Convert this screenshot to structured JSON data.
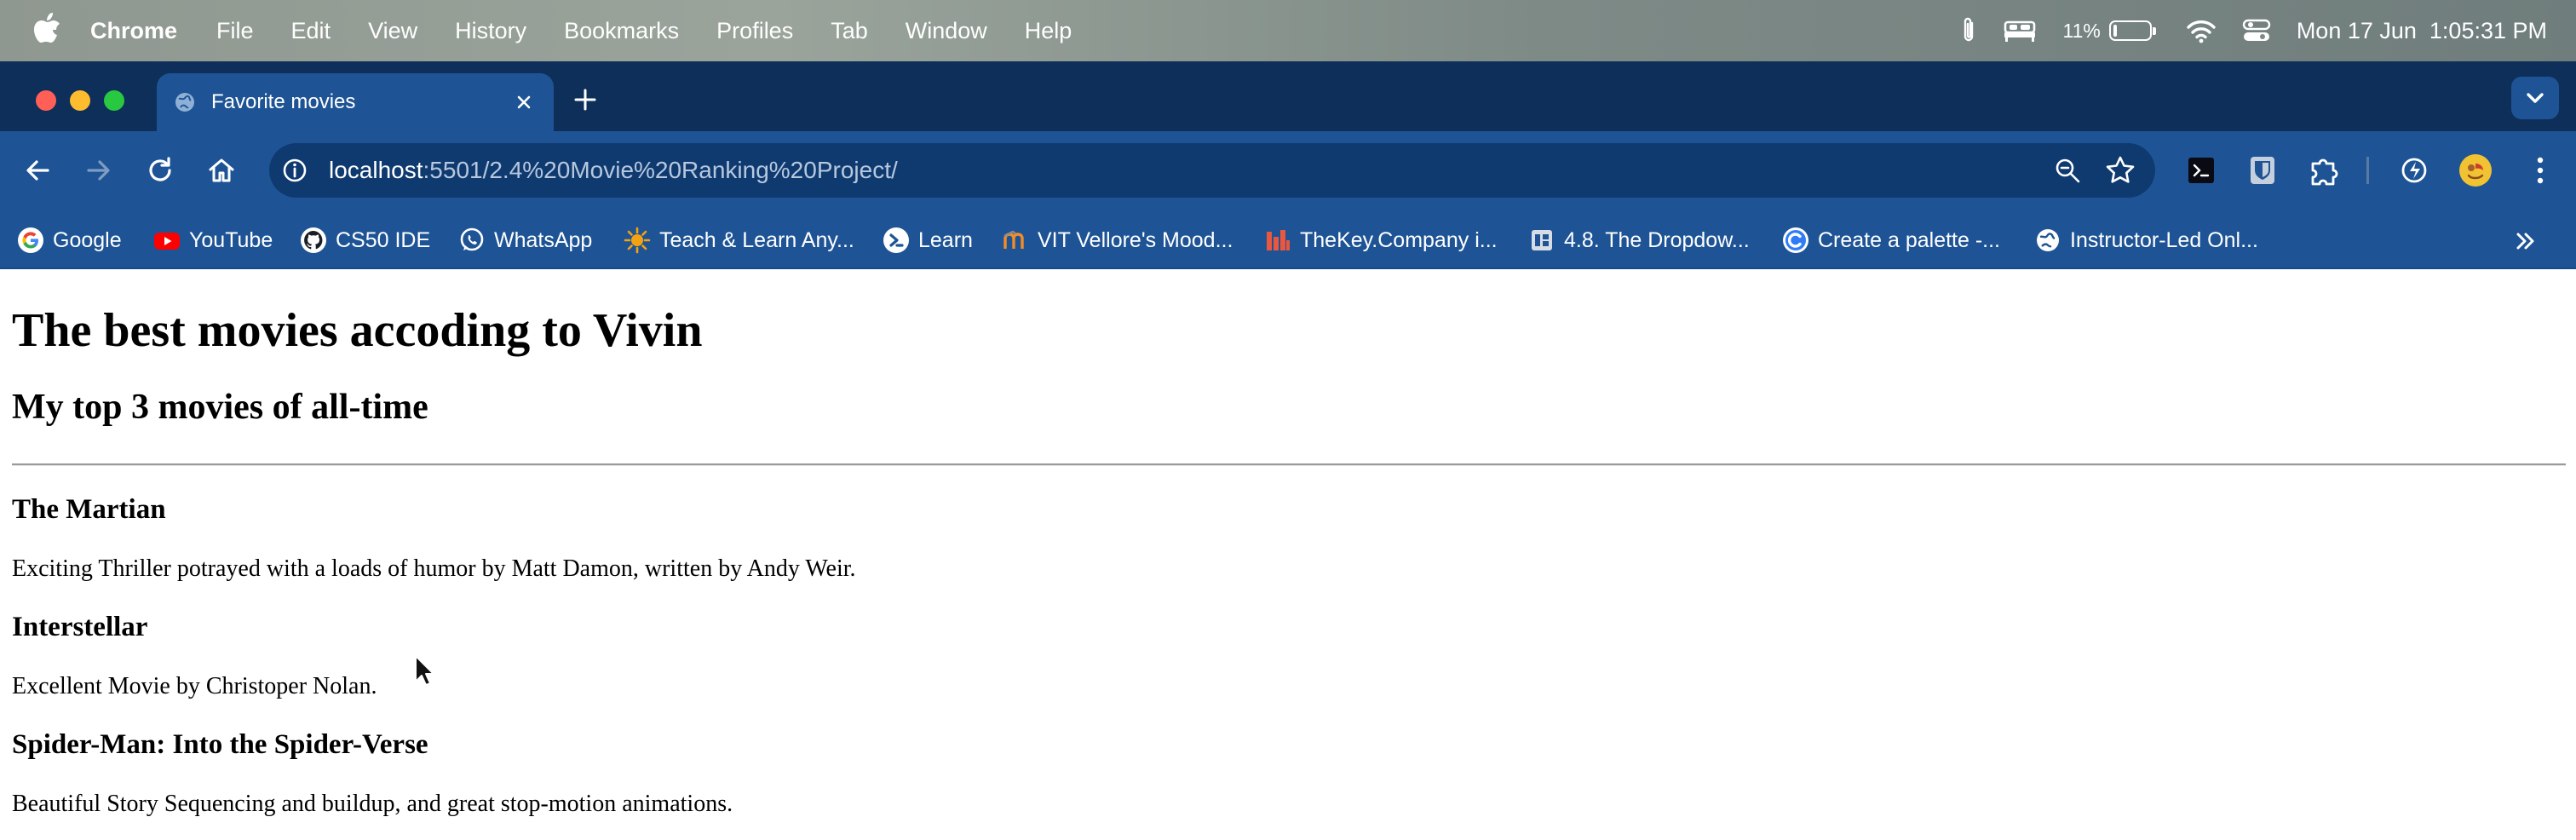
{
  "menubar": {
    "app_name": "Chrome",
    "items": [
      "File",
      "Edit",
      "View",
      "History",
      "Bookmarks",
      "Profiles",
      "Tab",
      "Window",
      "Help"
    ],
    "battery_percent": "11%",
    "battery_level": 0.11,
    "datetime": "Mon 17 Jun  1:05:31 PM"
  },
  "tab": {
    "title": "Favorite movies"
  },
  "address_bar": {
    "host": "localhost",
    "path": ":5501/2.4%20Movie%20Ranking%20Project/"
  },
  "bookmarks": [
    {
      "label": "Google",
      "icon": "google-icon"
    },
    {
      "label": "YouTube",
      "icon": "youtube-icon"
    },
    {
      "label": "CS50 IDE",
      "icon": "github-icon"
    },
    {
      "label": "WhatsApp",
      "icon": "whatsapp-icon"
    },
    {
      "label": "Teach & Learn Any...",
      "icon": "sun-icon"
    },
    {
      "label": "Learn",
      "icon": "terminal-icon"
    },
    {
      "label": "VIT Vellore's Mood...",
      "icon": "moodle-icon"
    },
    {
      "label": "TheKey.Company i...",
      "icon": "thekey-icon"
    },
    {
      "label": "4.8. The Dropdow...",
      "icon": "page-icon"
    },
    {
      "label": "Create a palette -...",
      "icon": "palette-icon"
    },
    {
      "label": "Instructor-Led Onl...",
      "icon": "globe-icon"
    }
  ],
  "page": {
    "heading": "The best movies accoding to Vivin",
    "subheading": "My top 3 movies of all-time",
    "movies": [
      {
        "title": "The Martian",
        "description": "Exciting Thriller potrayed with a loads of humor by Matt Damon, written by Andy Weir."
      },
      {
        "title": "Interstellar",
        "description": "Excellent Movie by Christoper Nolan."
      },
      {
        "title": "Spider-Man: Into the Spider-Verse",
        "description": "Beautiful Story Sequencing and buildup, and great stop-motion animations."
      }
    ]
  },
  "colors": {
    "tab_strip": "#0e2f59",
    "toolbar": "#1e5495",
    "omnibox": "#0f3a70"
  }
}
